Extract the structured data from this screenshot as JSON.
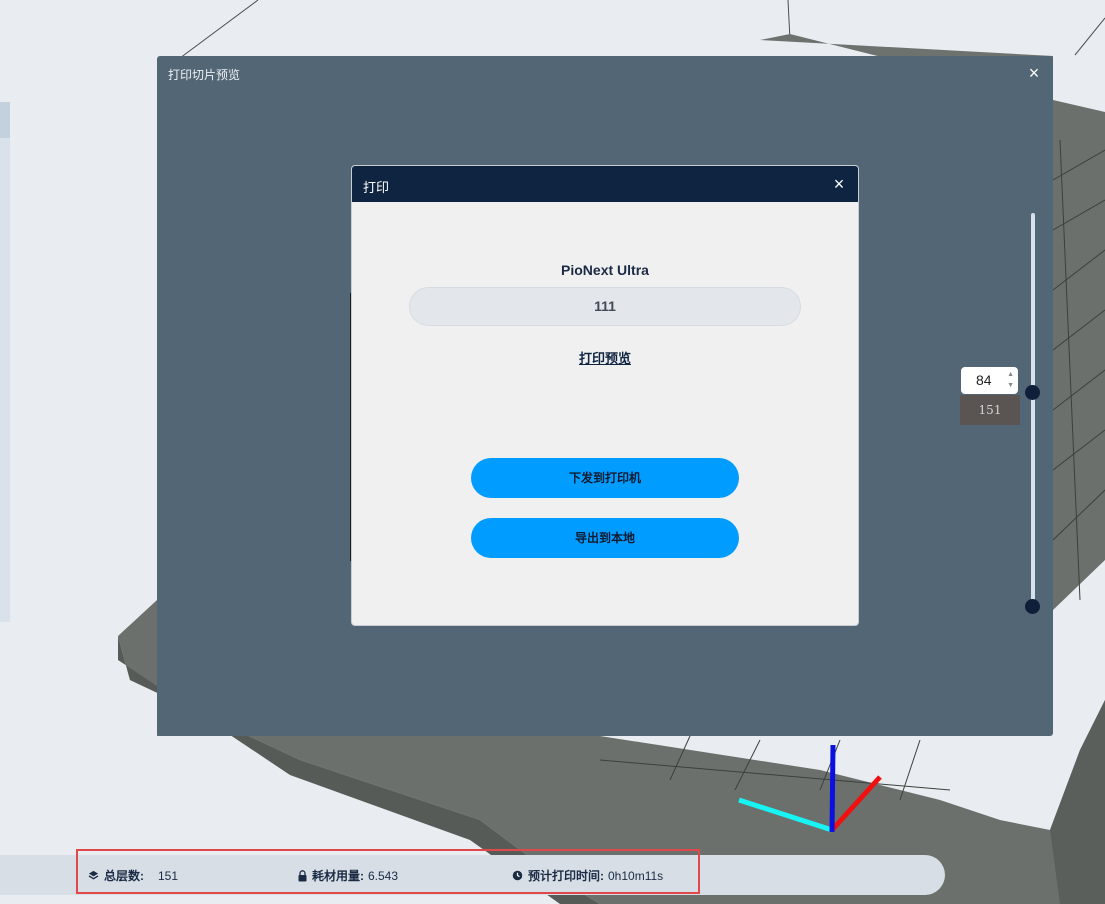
{
  "preview_window": {
    "title": "打印切片预览",
    "close_icon": "×"
  },
  "layer_slider": {
    "current_layer": "84",
    "total_layers": "151"
  },
  "print_dialog": {
    "title": "打印",
    "close_icon": "×",
    "printer_name": "PioNext Ultra",
    "file_name": "111",
    "preview_link": "打印预览",
    "send_button": "下发到打印机",
    "export_button": "导出到本地"
  },
  "status_bar": {
    "layers_label": "总层数:",
    "layers_value": "151",
    "filament_label": "耗材用量:",
    "filament_value": "6.543",
    "time_label": "预计打印时间:",
    "time_value": "0h10m11s"
  },
  "colors": {
    "accent": "#009cff",
    "dialog_header": "#0f2441",
    "highlight": "#e0484a"
  }
}
